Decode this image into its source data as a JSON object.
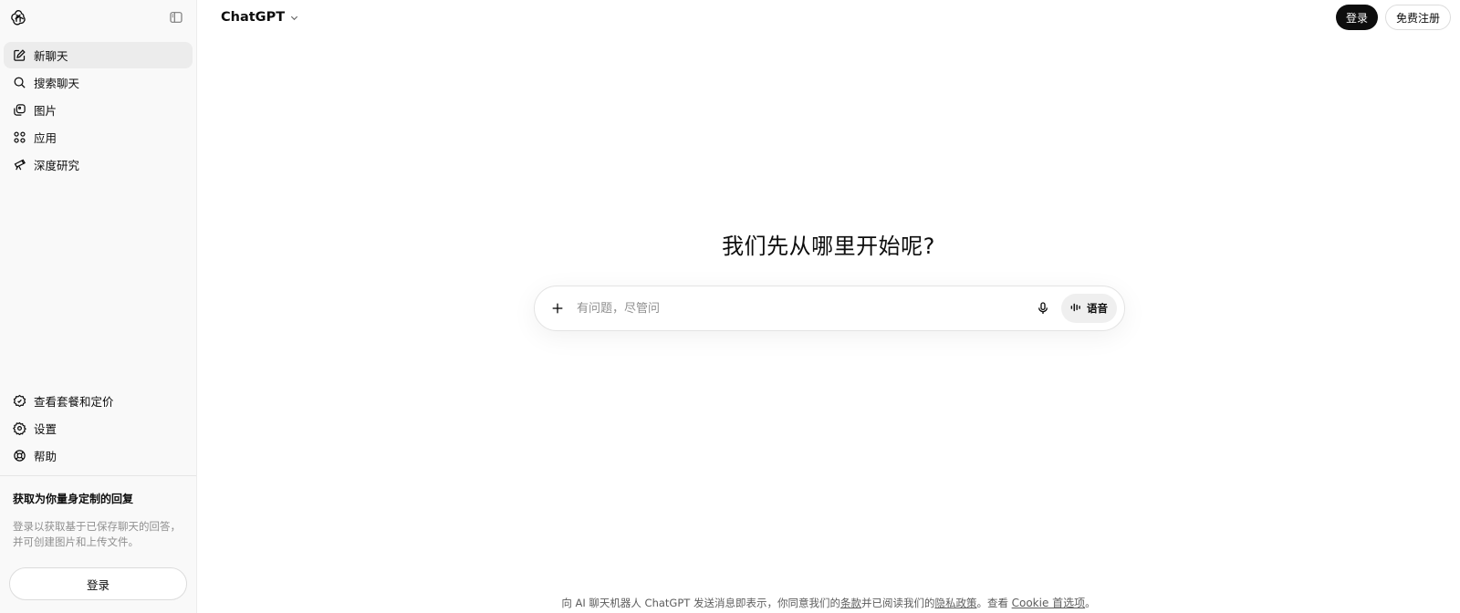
{
  "sidebar": {
    "logo_icon": "openai-logo-icon",
    "toggle_icon": "sidebar-toggle-icon",
    "nav": [
      {
        "label": "新聊天",
        "icon": "edit-icon",
        "active": true
      },
      {
        "label": "搜索聊天",
        "icon": "search-icon",
        "active": false
      },
      {
        "label": "图片",
        "icon": "images-icon",
        "active": false
      },
      {
        "label": "应用",
        "icon": "apps-icon",
        "active": false
      },
      {
        "label": "深度研究",
        "icon": "telescope-icon",
        "active": false
      }
    ],
    "bottom_links": [
      {
        "label": "查看套餐和定价",
        "icon": "pricing-badge-icon"
      },
      {
        "label": "设置",
        "icon": "gear-icon"
      },
      {
        "label": "帮助",
        "icon": "help-lifebuoy-icon"
      }
    ],
    "promo_title": "获取为你量身定制的回复",
    "promo_text": "登录以获取基于已保存聊天的回答，并可创建图片和上传文件。",
    "login_button": "登录"
  },
  "header": {
    "model_name": "ChatGPT",
    "login_button": "登录",
    "signup_button": "免费注册"
  },
  "main": {
    "headline": "我们先从哪里开始呢?",
    "composer_placeholder": "有问题，尽管问",
    "voice_label": "语音"
  },
  "footer": {
    "prefix": "向 AI 聊天机器人 ChatGPT 发送消息即表示，你同意我们的",
    "terms": "条款",
    "middle": "并已阅读我们的",
    "privacy": "隐私政策",
    "check": "。查看 ",
    "cookie": "Cookie 首选项",
    "end": "。"
  },
  "colors": {
    "sidebar_bg": "#f9f9f9",
    "active_item_bg": "#ececec",
    "primary_button": "#0d0d0d",
    "muted_text": "#8f8f8f"
  }
}
